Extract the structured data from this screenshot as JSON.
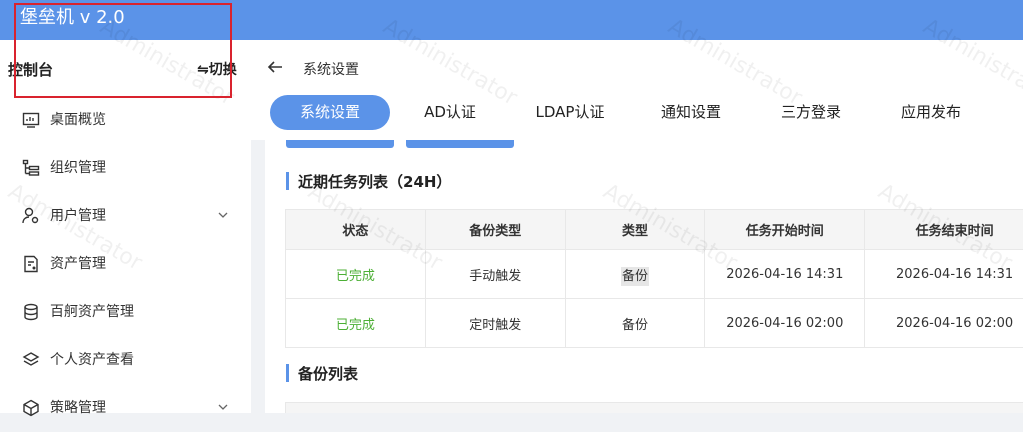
{
  "app": {
    "title": "堡垒机 v 2.0"
  },
  "sidebar": {
    "console_label": "控制台",
    "switch_label": "⇋切换",
    "items": [
      {
        "label": "桌面概览",
        "icon": "dashboard-icon",
        "has_chevron": false
      },
      {
        "label": "组织管理",
        "icon": "org-tree-icon",
        "has_chevron": false
      },
      {
        "label": "用户管理",
        "icon": "user-settings-icon",
        "has_chevron": true
      },
      {
        "label": "资产管理",
        "icon": "asset-doc-icon",
        "has_chevron": false
      },
      {
        "label": "百舸资产管理",
        "icon": "database-icon",
        "has_chevron": false
      },
      {
        "label": "个人资产查看",
        "icon": "layers-icon",
        "has_chevron": false
      },
      {
        "label": "策略管理",
        "icon": "cube-icon",
        "has_chevron": true
      }
    ]
  },
  "breadcrumb": {
    "text": "系统设置"
  },
  "tabs": [
    "系统设置",
    "AD认证",
    "LDAP认证",
    "通知设置",
    "三方登录",
    "应用发布"
  ],
  "sections": {
    "recent_tasks_title": "近期任务列表（24H）",
    "backup_list_title": "备份列表"
  },
  "tasks_table": {
    "headers": [
      "状态",
      "备份类型",
      "类型",
      "任务开始时间",
      "任务结束时间"
    ],
    "rows": [
      [
        "已完成",
        "手动触发",
        "备份",
        "2026-04-16 14:31",
        "2026-04-16 14:31"
      ],
      [
        "已完成",
        "定时触发",
        "备份",
        "2026-04-16 02:00",
        "2026-04-16 02:00"
      ]
    ]
  },
  "watermark": "Administrator",
  "colors": {
    "accent": "#5b93e8",
    "success": "#4caf35",
    "highlight_box": "#d9232e"
  }
}
